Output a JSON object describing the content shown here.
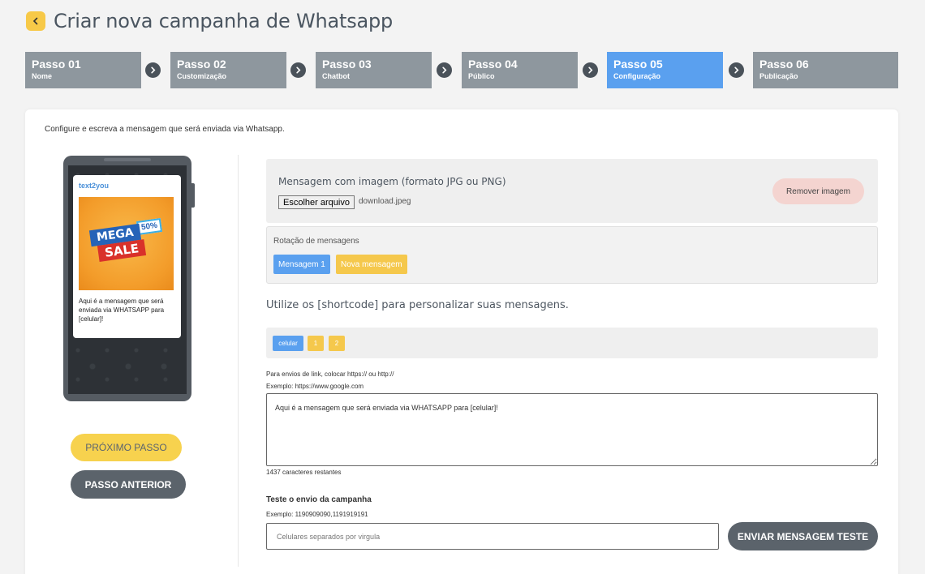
{
  "header": {
    "title": "Criar nova campanha de Whatsapp"
  },
  "steps": [
    {
      "title": "Passo 01",
      "subtitle": "Nome",
      "active": false
    },
    {
      "title": "Passo 02",
      "subtitle": "Customização",
      "active": false
    },
    {
      "title": "Passo 03",
      "subtitle": "Chatbot",
      "active": false
    },
    {
      "title": "Passo 04",
      "subtitle": "Público",
      "active": false
    },
    {
      "title": "Passo 05",
      "subtitle": "Configuração",
      "active": true
    },
    {
      "title": "Passo 06",
      "subtitle": "Publicação",
      "active": false
    }
  ],
  "intro": "Configure e escreva a mensagem que será enviada via Whatsapp.",
  "preview": {
    "brand": "text2you",
    "image_text": {
      "mega": "MEGA",
      "sale": "SALE",
      "percent": "50%"
    },
    "message": "Aqui é a mensagem que será enviada via WHATSAPP para [celular]!"
  },
  "nav": {
    "next": "PRÓXIMO PASSO",
    "prev": "PASSO ANTERIOR"
  },
  "upload": {
    "label": "Mensagem com imagem (formato JPG ou PNG)",
    "file_button": "Escolher arquivo",
    "file_name": "download.jpeg",
    "remove": "Remover imagem"
  },
  "rotation": {
    "label": "Rotação de mensagens",
    "tabs": [
      "Mensagem 1",
      "Nova mensagem"
    ]
  },
  "shortcodes": {
    "title": "Utilize os [shortcode] para personalizar suas mensagens.",
    "items": [
      "celular",
      "1",
      "2"
    ]
  },
  "message_field": {
    "help1": "Para envios de link, colocar https:// ou http://",
    "help2": "Exemplo: https://www.google.com",
    "value": "Aqui é a mensagem que será enviada via WHATSAPP para [celular]!",
    "chars_left": "1437 caracteres restantes"
  },
  "test": {
    "title": "Teste o envio da campanha",
    "example": "Exemplo: 1190909090,1191919191",
    "placeholder": "Celulares separados por virgula",
    "send": "ENVIAR MENSAGEM TESTE"
  },
  "colors": {
    "accent_blue": "#5aa0ef",
    "accent_yellow": "#f7d24e",
    "step_gray": "#8e979e",
    "dark_button": "#5b636b"
  }
}
